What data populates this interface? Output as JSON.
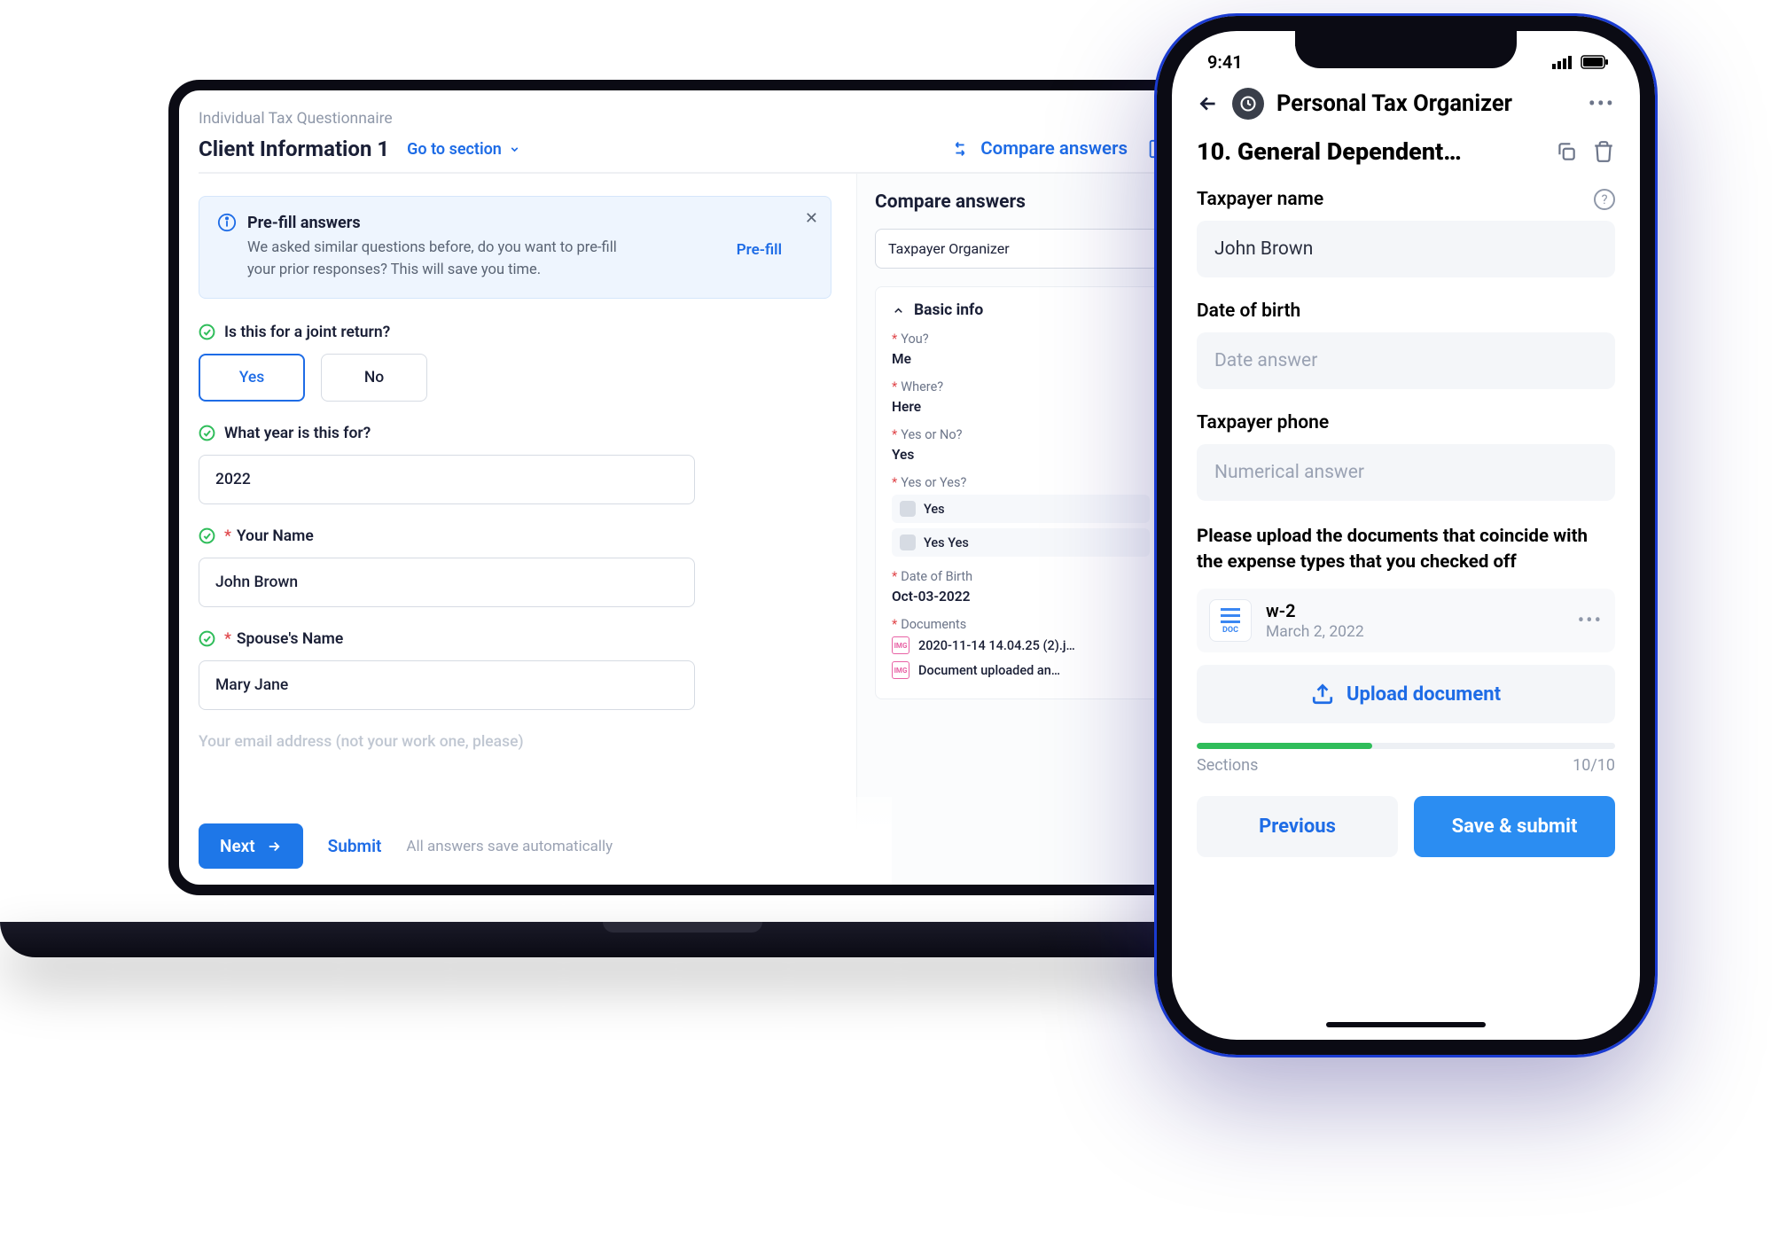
{
  "laptop": {
    "breadcrumb": "Individual Tax Questionnaire",
    "section_title": "Client Information 1",
    "goto_label": "Go to section",
    "compare_label": "Compare answers",
    "banner": {
      "title": "Pre-fill answers",
      "body": "We asked similar questions before, do you want to pre-fill your prior responses? This will save you time.",
      "action": "Pre-fill"
    },
    "questions": {
      "q1": {
        "label": "Is this for a joint return?",
        "yes": "Yes",
        "no": "No"
      },
      "q2": {
        "label": "What year is this for?",
        "value": "2022"
      },
      "q3": {
        "label": "Your Name",
        "value": "John Brown"
      },
      "q4": {
        "label": "Spouse's Name",
        "value": "Mary Jane"
      },
      "q5_ghost": "Your email address (not your work one, please)"
    },
    "footer": {
      "next": "Next",
      "submit": "Submit",
      "hint": "All answers save automatically"
    },
    "panel": {
      "title": "Compare answers",
      "dropdown": "Taxpayer Organizer",
      "section": "Basic info",
      "f1_label": "You?",
      "f1_val": "Me",
      "f2_label": "Where?",
      "f2_val": "Here",
      "f3_label": "Yes or No?",
      "f3_val": "Yes",
      "f4_label": "Yes or Yes?",
      "f4_opt1": "Yes",
      "f4_opt2": "Yes Yes",
      "f5_label": "Date of Birth",
      "f5_val": "Oct-03-2022",
      "f6_label": "Documents",
      "doc1": "2020-11-14 14.04.25 (2).j…",
      "doc2": "Document uploaded an…"
    }
  },
  "phone": {
    "status_time": "9:41",
    "header_title": "Personal Tax Organizer",
    "section_title": "10. General Dependent…",
    "taxpayer_name_label": "Taxpayer name",
    "taxpayer_name_value": "John Brown",
    "dob_label": "Date of birth",
    "dob_placeholder": "Date answer",
    "phone_label": "Taxpayer phone",
    "phone_placeholder": "Numerical answer",
    "upload_prompt": "Please upload the documents that coincide with the expense types that you checked off",
    "file_name": "w-2",
    "file_date": "March 2, 2022",
    "upload_btn": "Upload document",
    "sections_label": "Sections",
    "sections_count": "10/10",
    "btn_prev": "Previous",
    "btn_save": "Save & submit"
  }
}
